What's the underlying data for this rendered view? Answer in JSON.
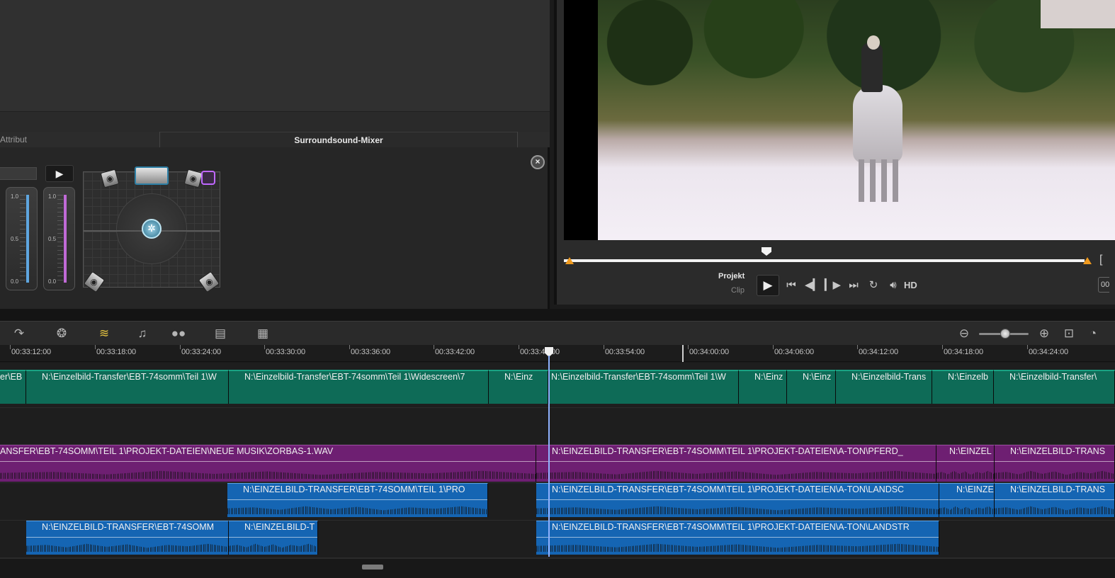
{
  "panel": {
    "tab_attribut": "Attribut",
    "tab_surround": "Surroundsound-Mixer"
  },
  "mixer": {
    "fader_scale": [
      "1.0",
      "0.5",
      "0.0"
    ],
    "fader1_color": "#5fa6e0",
    "fader2_color": "#c06ad6"
  },
  "preview": {
    "project_label": "Projekt",
    "clip_label": "Clip",
    "hd_label": "HD",
    "edge_bracket": "[",
    "edge_button": "00"
  },
  "ruler": {
    "labels": [
      "00:33:12:00",
      "00:33:18:00",
      "00:33:24:00",
      "00:33:30:00",
      "00:33:36:00",
      "00:33:42:00",
      "00:33:48:00",
      "00:33:54:00",
      "00:34:00:00",
      "00:34:06:00",
      "00:34:12:00",
      "00:34:18:00",
      "00:34:24:00"
    ]
  },
  "tracks": {
    "video": [
      "er\\EB",
      "N:\\Einzelbild-Transfer\\EBT-74somm\\Teil 1\\W",
      "N:\\Einzelbild-Transfer\\EBT-74somm\\Teil 1\\Widescreen\\7",
      "N:\\Einz",
      "N:\\Einzelbild-Transfer\\EBT-74somm\\Teil 1\\W",
      "N:\\Einz",
      "N:\\Einz",
      "N:\\Einzelbild-Trans",
      "N:\\Einzelb",
      "N:\\Einzelbild-Transfer\\"
    ],
    "music": [
      "ANSFER\\EBT-74SOMM\\TEIL 1\\PROJEKT-DATEIEN\\NEUE MUSIK\\ZORBAS-1.WAV",
      "N:\\EINZELBILD-TRANSFER\\EBT-74SOMM\\TEIL 1\\PROJEKT-DATEIEN\\A-TON\\PFERD_",
      "N:\\EINZEL",
      "N:\\EINZELBILD-TRANS"
    ],
    "audio1": [
      "N:\\EINZELBILD-TRANSFER\\EBT-74SOMM\\TEIL 1\\PRO",
      "N:\\EINZELBILD-TRANSFER\\EBT-74SOMM\\TEIL 1\\PROJEKT-DATEIEN\\A-TON\\LANDSC",
      "N:\\EINZE",
      "N:\\EINZELBILD-TRANS"
    ],
    "audio2": [
      "N:\\EINZELBILD-TRANSFER\\EBT-74SOMM",
      "N:\\EINZELBILD-T",
      "N:\\EINZELBILD-TRANSFER\\EBT-74SOMM\\TEIL 1\\PROJEKT-DATEIEN\\A-TON\\LANDSTR"
    ]
  },
  "colors": {
    "video_clip": "#0e6b57",
    "music_clip": "#6e1f72",
    "audio_clip": "#1565b3",
    "playhead": "#8fb2ff",
    "marker": "#f09a1e"
  }
}
